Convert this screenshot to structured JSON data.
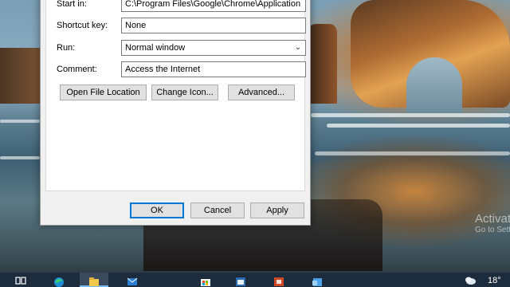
{
  "dialog": {
    "rows": {
      "start_in": {
        "label": "Start in:",
        "value": "C:\\Program Files\\Google\\Chrome\\Application"
      },
      "shortcut_key": {
        "label": "Shortcut key:",
        "value": "None"
      },
      "run": {
        "label": "Run:",
        "value": "Normal window"
      },
      "comment": {
        "label": "Comment:",
        "value": "Access the Internet"
      }
    },
    "buttons": {
      "open_file_location": "Open File Location",
      "change_icon": "Change Icon...",
      "advanced": "Advanced..."
    },
    "footer": {
      "ok": "OK",
      "cancel": "Cancel",
      "apply": "Apply"
    }
  },
  "desktop": {
    "watermark": "Activate",
    "watermark_sub": "Go to Settings to activate Windows."
  },
  "taskbar": {
    "icons": [
      "task-view-icon",
      "edge-icon",
      "file-explorer-icon",
      "mail-icon",
      "store-icon",
      "app-icon",
      "powerpoint-icon",
      "app-icon-2"
    ],
    "active_index": 2,
    "weather_temp": "18°",
    "colors": {
      "taskbar": "#1d2c3c",
      "accent": "#76b9ed"
    }
  }
}
